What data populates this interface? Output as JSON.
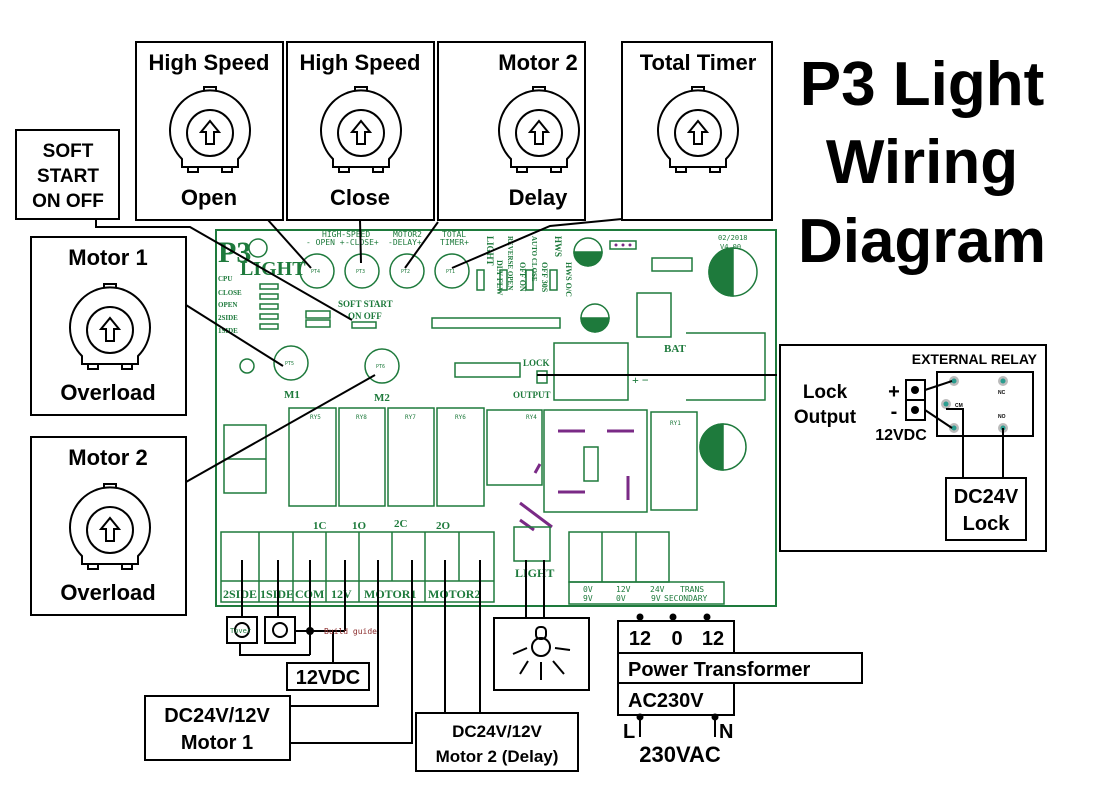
{
  "title": {
    "line1": "P3 Light",
    "line2": "Wiring",
    "line3": "Diagram"
  },
  "callouts": {
    "soft_start": [
      "SOFT",
      "START",
      "ON OFF"
    ],
    "pots": [
      {
        "top": "High Speed",
        "bottom": "Open"
      },
      {
        "top": "High Speed",
        "bottom": "Close"
      },
      {
        "top": "Motor 2",
        "bottom": "Delay"
      },
      {
        "top": "Total Timer",
        "bottom": ""
      }
    ],
    "overloads": [
      {
        "top": "Motor 1",
        "bottom": "Overload"
      },
      {
        "top": "Motor 2",
        "bottom": "Overload"
      }
    ]
  },
  "pcb": {
    "brand": "P3",
    "brand2": "LIGHT",
    "version_date": "02/2018",
    "version": "V4.00",
    "leds": [
      "CPU",
      "CLOSE",
      "OPEN",
      "2SIDE",
      "1SIDE"
    ],
    "pot_headers": [
      "HIGH-SPEED",
      "- OPEN +",
      "-CLOSE+",
      "MOTOR2",
      "-DELAY+",
      "TOTAL",
      "TIMER+"
    ],
    "pot_ids": [
      "PT4",
      "PT3",
      "PT2",
      "PT1",
      "PT5",
      "PT6"
    ],
    "jumpers": [
      {
        "name": "LIGHT",
        "opts": "DLY FLW"
      },
      {
        "name": "REVERSE OPEN",
        "opts": "OFF ON"
      },
      {
        "name": "AUTO CLOSE",
        "opts": "OFF 30S"
      },
      {
        "name": "HWS",
        "opts": "HWS O/C"
      }
    ],
    "soft_start": [
      "SOFT START",
      "ON OFF"
    ],
    "motor_labels": [
      "M1",
      "M2"
    ],
    "lock_labels": [
      "LOCK",
      "OUTPUT"
    ],
    "bat": "BAT",
    "limit_labels": [
      "1C",
      "1O",
      "2C",
      "2O"
    ],
    "relays": [
      "RY5",
      "RY8",
      "RY7",
      "RY6",
      "RY4",
      "RY1"
    ],
    "terminals": [
      "2SIDE",
      "1SIDE",
      "COM",
      "12V",
      "MOTOR1",
      "MOTOR2"
    ],
    "light_label": "LIGHT",
    "trans_terminals": [
      {
        "top": "0V",
        "bottom": "9V"
      },
      {
        "top": "12V",
        "bottom": "0V"
      },
      {
        "top": "24V",
        "bottom": "9V"
      }
    ],
    "trans_label": [
      "TRANS",
      "SECONDARY"
    ]
  },
  "external_relay": {
    "title": "EXTERNAL RELAY",
    "lock_output": [
      "Lock",
      "Output"
    ],
    "plus": "+",
    "minus": "-",
    "voltage": "12VDC",
    "pins": [
      "CM",
      "NC",
      "NO"
    ],
    "lock_box": [
      "DC24V",
      "Lock"
    ]
  },
  "bottom": {
    "switch_label": "Tover",
    "watermark": "Build guide",
    "supply": "12VDC",
    "motor1": [
      "DC24V/12V",
      "Motor 1"
    ],
    "motor2": [
      "DC24V/12V",
      "Motor 2 (Delay)"
    ],
    "transformer": {
      "taps": [
        "12",
        "0",
        "12"
      ],
      "name": "Power Transformer",
      "primary": "AC230V",
      "l": "L",
      "n": "N",
      "mains": "230VAC"
    }
  },
  "colors": {
    "pcb_green": "#1e7a3c",
    "purple": "#7a2a86",
    "relay_dot": "#2a9d8f"
  }
}
